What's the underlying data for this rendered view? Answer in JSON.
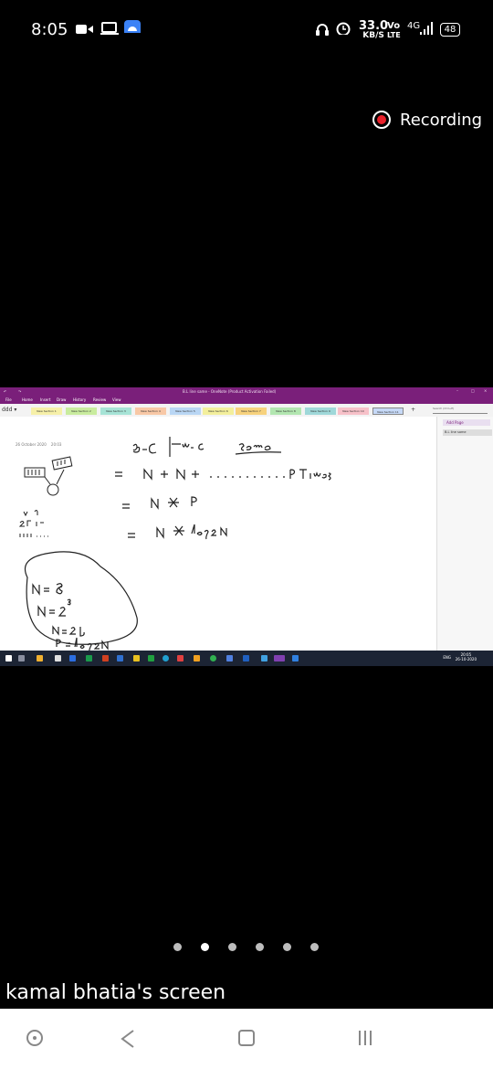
{
  "status_bar": {
    "time": "8:05",
    "net_speed": "33.0",
    "net_unit": "KB/S",
    "volte_top": "Vo",
    "volte_bottom": "LTE",
    "network": "4G",
    "battery": "48",
    "left_icons": [
      "video-call-icon",
      "laptop-icon",
      "android-debug-icon"
    ],
    "right_icons": [
      "headset-icon",
      "alarm-icon",
      "signal-icon"
    ]
  },
  "recording": {
    "label": "Recording",
    "accent": "#e8202a"
  },
  "shared_screen": {
    "window_title": "B.L line same - OneNote (Product Activation Failed)",
    "menu": [
      "File",
      "Home",
      "Insert",
      "Draw",
      "History",
      "Review",
      "View"
    ],
    "notebook": "ddd",
    "section_tabs": [
      "New Section 1",
      "New Section 2",
      "New Section 3",
      "New Section 4",
      "New Section 5",
      "New Section 6",
      "New Section 7",
      "New Section 8",
      "New Section 9",
      "New Section 10",
      "New Section 11"
    ],
    "search_placeholder": "Search (Ctrl+E)",
    "date": "26 October 2020",
    "date_time": "20:03",
    "add_page": "Add Page",
    "page_item": "B.L line same",
    "handwriting": {
      "line1": "B-C  | w-c    same",
      "line2": "= N + N + ........ P Times",
      "line3": "= N * P",
      "line4": "= N * log2N",
      "side": "N= 8   N = 2^3   N = 2^P   P = log2N",
      "marks": "u n  2L L-  1 1 1 . . . ."
    },
    "taskbar_clock": "20:05",
    "taskbar_date": "26-10-2020",
    "taskbar_lang": "ENG",
    "brand_color": "#7a1f7a"
  },
  "pager": {
    "count": 6,
    "active_index": 1
  },
  "caption": "kamal bhatia's screen",
  "nav_icons": [
    "assistant-icon",
    "back-icon",
    "home-icon",
    "recents-icon"
  ]
}
